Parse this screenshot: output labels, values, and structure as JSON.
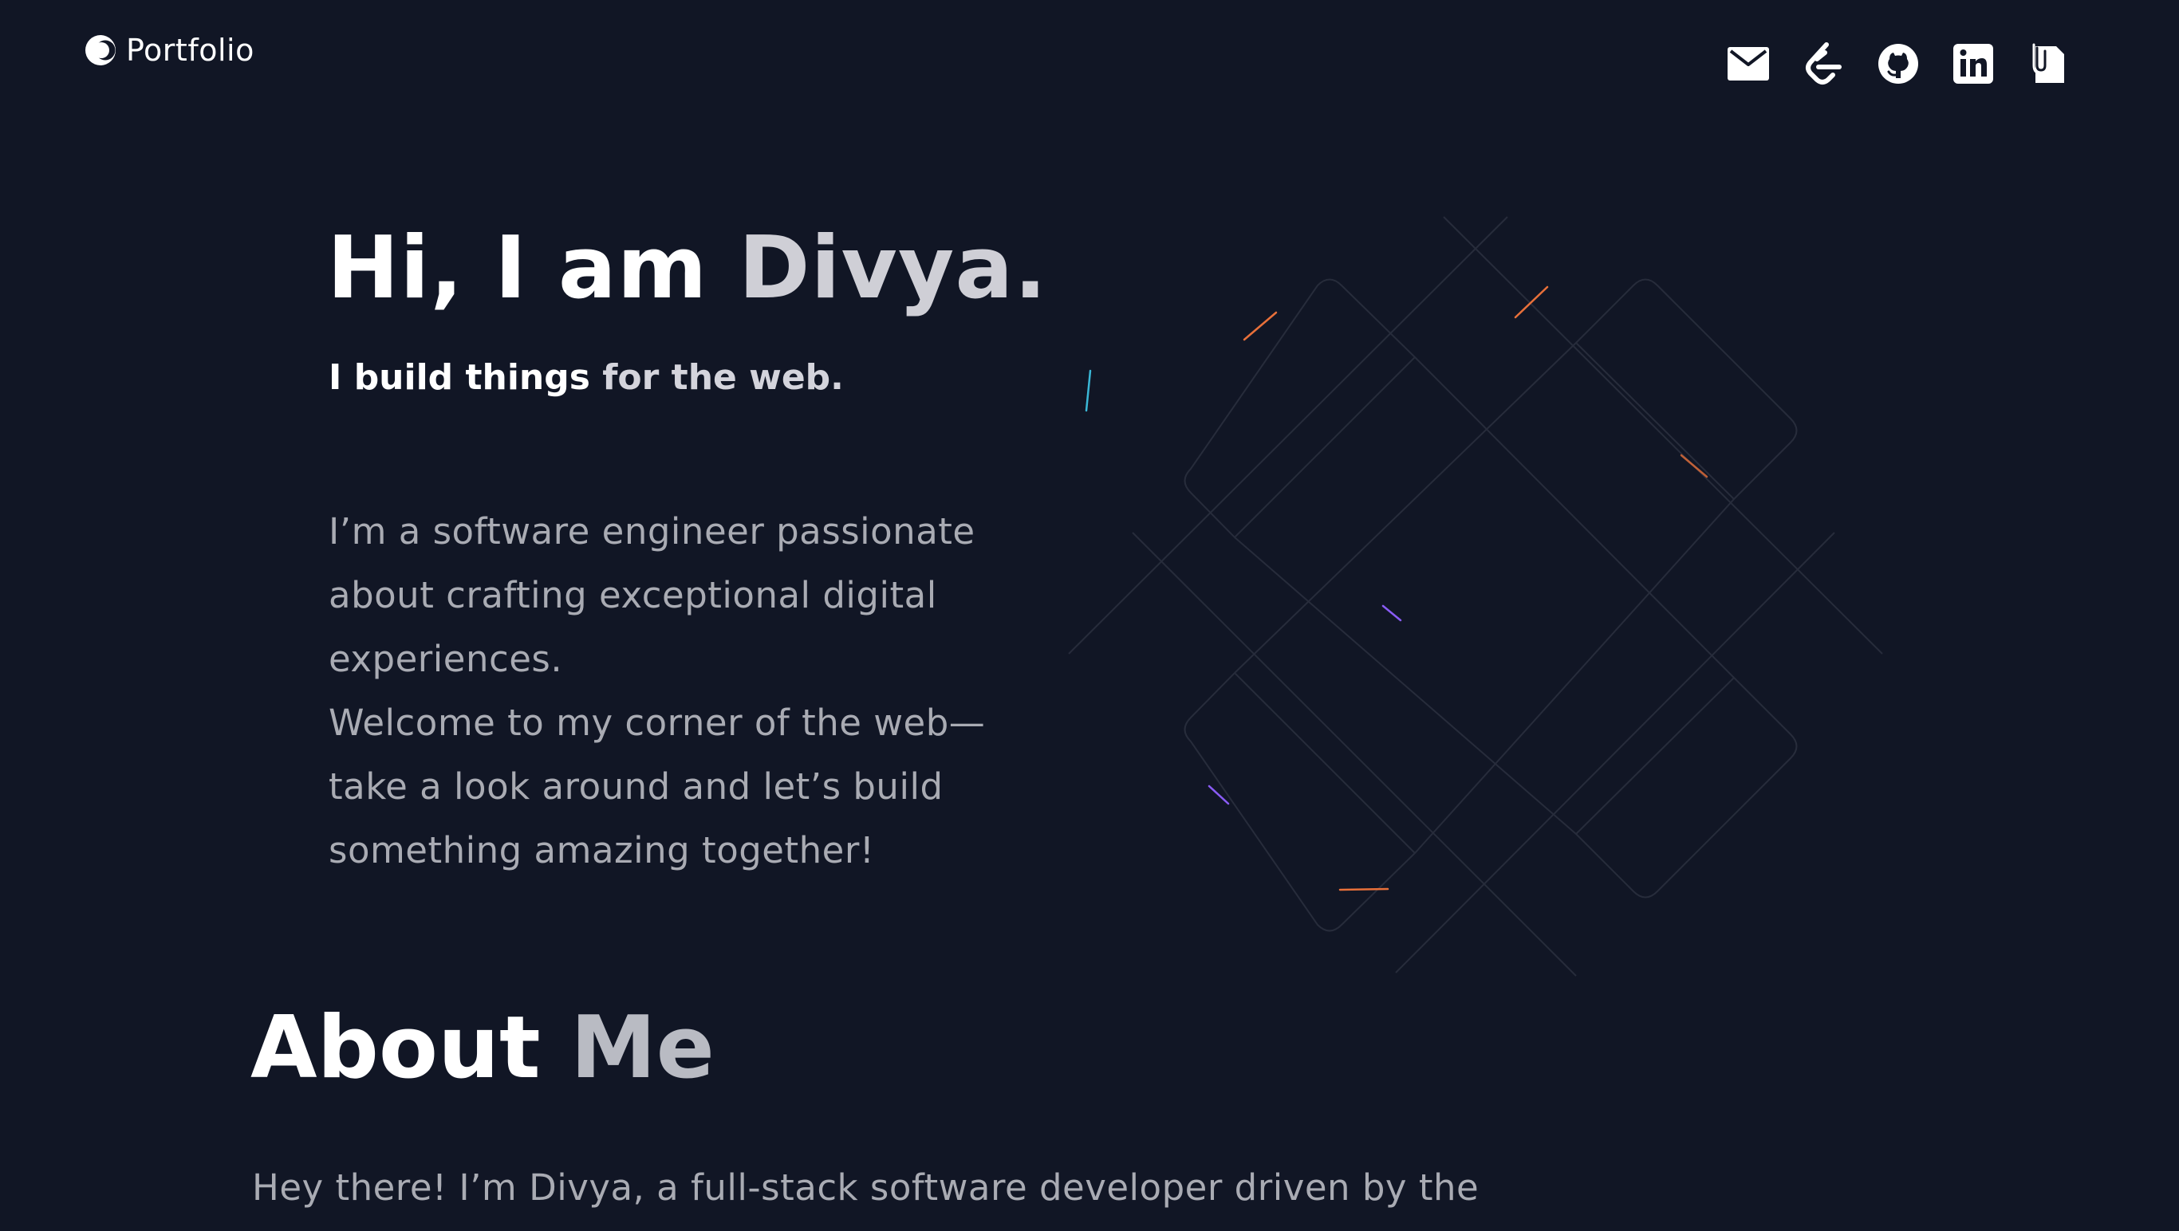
{
  "header": {
    "brand_label": "Portfolio",
    "brand_icon": "crescent-logo-icon",
    "social_links": [
      {
        "icon": "email-icon"
      },
      {
        "icon": "leetcode-icon"
      },
      {
        "icon": "github-icon"
      },
      {
        "icon": "linkedin-icon"
      },
      {
        "icon": "resume-icon"
      }
    ]
  },
  "hero": {
    "title_part1": "Hi, I am ",
    "title_part2": "Divya.",
    "subtitle_part1": "I build things ",
    "subtitle_part2": "for the web.",
    "intro_line1": "I’m a software engineer passionate about crafting exceptional digital experiences.",
    "intro_line2": "Welcome to my corner of the web—take a look around and let’s build something amazing together!"
  },
  "about": {
    "title_part1": "About ",
    "title_part2": "Me",
    "text": "Hey there! I’m Divya, a full-stack software developer driven by the"
  },
  "colors": {
    "background": "#111625",
    "text_primary": "#ffffff",
    "text_muted": "#a9abb3",
    "grid_line": "#272c3b",
    "accent_orange": "#e8703a",
    "accent_purple": "#8a5cf6",
    "accent_cyan": "#3ab7d6"
  }
}
